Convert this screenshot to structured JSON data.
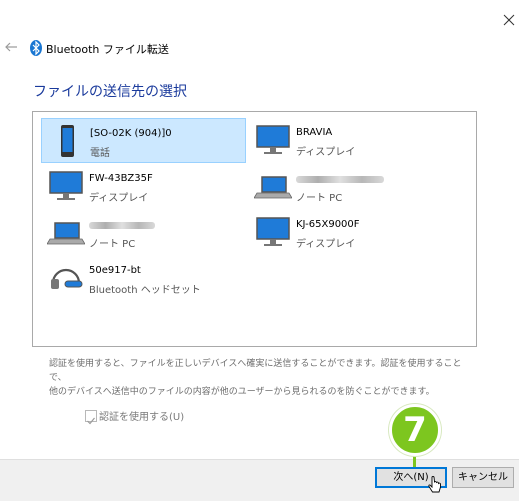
{
  "window": {
    "title": "Bluetooth ファイル転送",
    "close_glyph": "✕"
  },
  "page": {
    "heading": "ファイルの送信先の選択"
  },
  "devices": [
    {
      "name": "[SO-02K (904)]0",
      "type": "電話",
      "icon": "phone-icon",
      "selected": true
    },
    {
      "name": "BRAVIA",
      "type": "ディスプレイ",
      "icon": "monitor-icon",
      "selected": false
    },
    {
      "name": "FW-43BZ35F",
      "type": "ディスプレイ",
      "icon": "monitor-icon",
      "selected": false
    },
    {
      "name": "",
      "type": "ノート PC",
      "icon": "laptop-icon",
      "selected": false,
      "name_obscured": true
    },
    {
      "name": "",
      "type": "ノート PC",
      "icon": "laptop-icon",
      "selected": false,
      "name_obscured": true
    },
    {
      "name": "KJ-65X9000F",
      "type": "ディスプレイ",
      "icon": "monitor-icon",
      "selected": false
    },
    {
      "name": "50e917-bt",
      "type": "Bluetooth ヘッドセット",
      "icon": "headset-icon",
      "selected": false
    }
  ],
  "info_text": {
    "line1": "認証を使用すると、ファイルを正しいデバイスへ確実に送信することができます。認証を使用することで、",
    "line2": "他のデバイスへ送信中のファイルの内容が他のユーザーから見られるのを防ぐことができます。"
  },
  "auth_checkbox": {
    "label": "認証を使用する(U)",
    "checked": true,
    "enabled": false
  },
  "buttons": {
    "next": "次へ(N)",
    "cancel": "キャンセル"
  },
  "step_marker": {
    "number": "7",
    "color": "#7dc61f"
  },
  "colors": {
    "heading": "#1a3a9c",
    "selection": "#cce8ff",
    "accent": "#0078d7"
  }
}
